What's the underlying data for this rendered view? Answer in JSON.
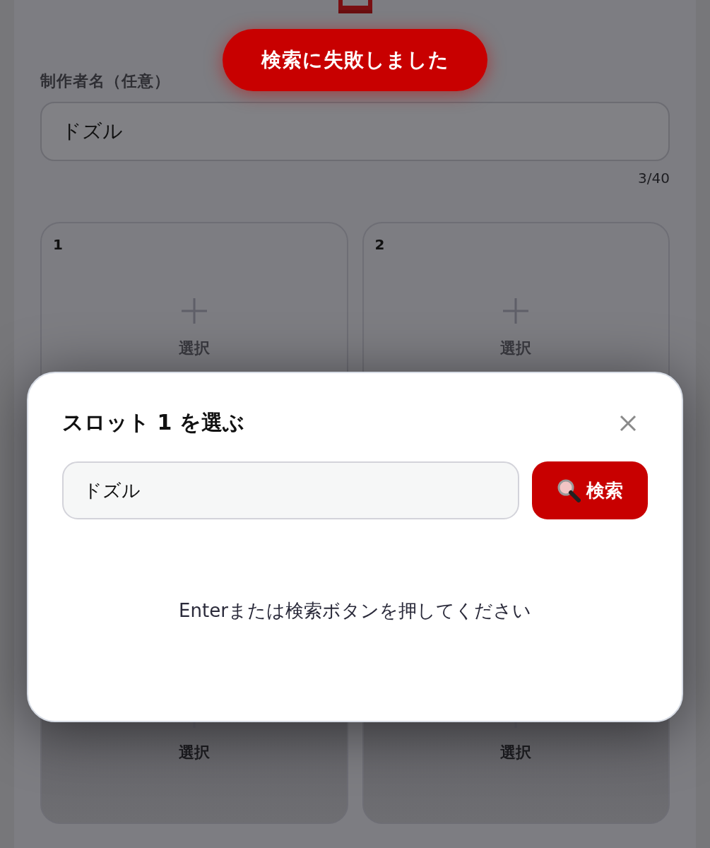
{
  "form": {
    "author_label": "制作者名（任意）",
    "author_value": "ドズル",
    "char_count": "3/40"
  },
  "slots": [
    {
      "number": "1",
      "action": "選択"
    },
    {
      "number": "2",
      "action": "選択"
    },
    {
      "action": "選択"
    },
    {
      "action": "選択"
    }
  ],
  "toast": {
    "message": "検索に失敗しました"
  },
  "modal": {
    "title": "スロット 1 を選ぶ",
    "search_value": "ドズル",
    "search_button": "検索",
    "hint": "Enterまたは検索ボタンを押してください"
  }
}
